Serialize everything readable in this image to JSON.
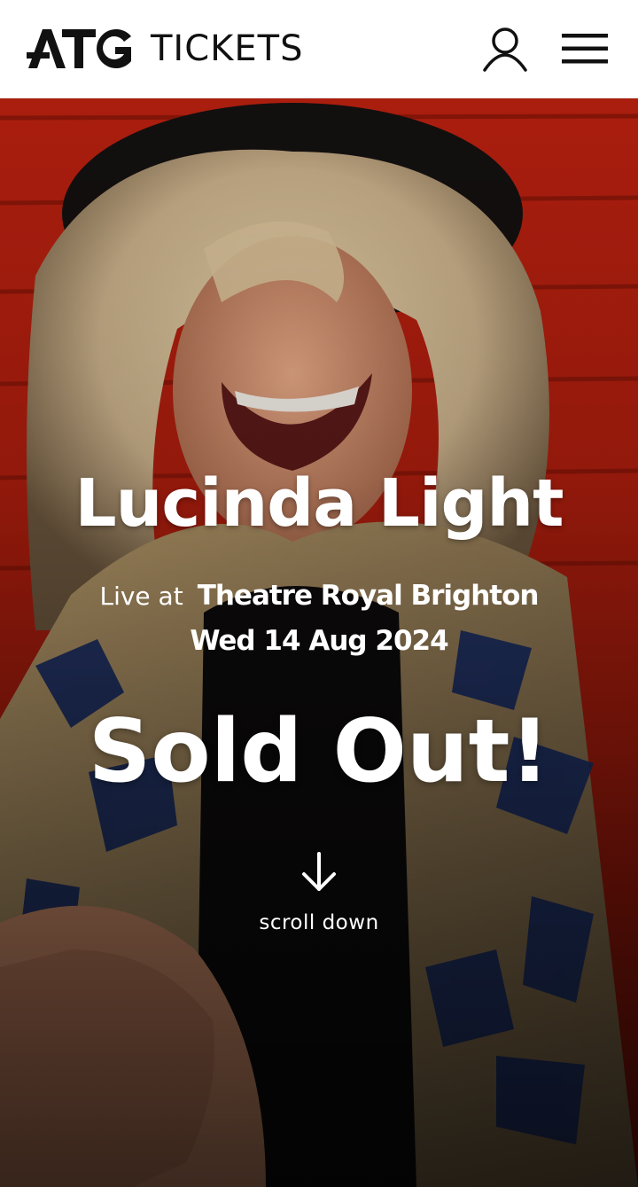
{
  "header": {
    "logo_text": "ATG",
    "tickets_label": "TICKETS",
    "icons": [
      "account-icon",
      "menu-icon"
    ]
  },
  "hero": {
    "artist": "Lucinda Light",
    "live_at": "Live at",
    "venue": "Theatre Royal Brighton",
    "date": "Wed 14 Aug 2024",
    "status": "Sold Out!",
    "scroll_label": "scroll down",
    "colors": {
      "background_red": "#b8200f",
      "text": "#ffffff"
    }
  }
}
